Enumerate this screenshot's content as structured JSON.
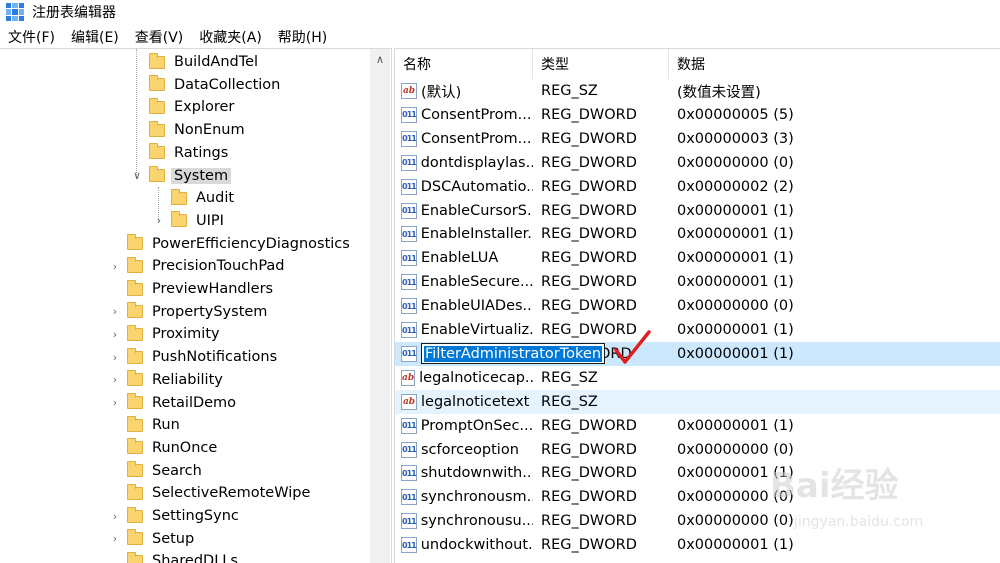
{
  "window": {
    "title": "注册表编辑器"
  },
  "menu": [
    "文件(F)",
    "编辑(E)",
    "查看(V)",
    "收藏夹(A)",
    "帮助(H)"
  ],
  "tree": {
    "nodes": [
      {
        "label": "BuildAndTel",
        "level": 2,
        "chevron": ""
      },
      {
        "label": "DataCollection",
        "level": 2,
        "chevron": ""
      },
      {
        "label": "Explorer",
        "level": 2,
        "chevron": ""
      },
      {
        "label": "NonEnum",
        "level": 2,
        "chevron": ""
      },
      {
        "label": "Ratings",
        "level": 2,
        "chevron": ""
      },
      {
        "label": "System",
        "level": 2,
        "chevron": "∨",
        "selected": true
      },
      {
        "label": "Audit",
        "level": 3,
        "chevron": ""
      },
      {
        "label": "UIPI",
        "level": 3,
        "chevron": "›"
      },
      {
        "label": "PowerEfficiencyDiagnostics",
        "level": 1,
        "chevron": ""
      },
      {
        "label": "PrecisionTouchPad",
        "level": 1,
        "chevron": "›"
      },
      {
        "label": "PreviewHandlers",
        "level": 1,
        "chevron": ""
      },
      {
        "label": "PropertySystem",
        "level": 1,
        "chevron": "›"
      },
      {
        "label": "Proximity",
        "level": 1,
        "chevron": "›"
      },
      {
        "label": "PushNotifications",
        "level": 1,
        "chevron": "›"
      },
      {
        "label": "Reliability",
        "level": 1,
        "chevron": "›"
      },
      {
        "label": "RetailDemo",
        "level": 1,
        "chevron": "›"
      },
      {
        "label": "Run",
        "level": 1,
        "chevron": ""
      },
      {
        "label": "RunOnce",
        "level": 1,
        "chevron": ""
      },
      {
        "label": "Search",
        "level": 1,
        "chevron": ""
      },
      {
        "label": "SelectiveRemoteWipe",
        "level": 1,
        "chevron": ""
      },
      {
        "label": "SettingSync",
        "level": 1,
        "chevron": "›"
      },
      {
        "label": "Setup",
        "level": 1,
        "chevron": "›"
      },
      {
        "label": "SharedDLLs",
        "level": 1,
        "chevron": ""
      }
    ]
  },
  "list": {
    "columns": [
      "名称",
      "类型",
      "数据"
    ],
    "rows": [
      {
        "name": "(默认)",
        "type": "REG_SZ",
        "data": "(数值未设置)",
        "icon": "ab"
      },
      {
        "name": "ConsentProm...",
        "type": "REG_DWORD",
        "data": "0x00000005 (5)",
        "icon": "bin"
      },
      {
        "name": "ConsentProm...",
        "type": "REG_DWORD",
        "data": "0x00000003 (3)",
        "icon": "bin"
      },
      {
        "name": "dontdisplaylas...",
        "type": "REG_DWORD",
        "data": "0x00000000 (0)",
        "icon": "bin"
      },
      {
        "name": "DSCAutomatio...",
        "type": "REG_DWORD",
        "data": "0x00000002 (2)",
        "icon": "bin"
      },
      {
        "name": "EnableCursorS...",
        "type": "REG_DWORD",
        "data": "0x00000001 (1)",
        "icon": "bin"
      },
      {
        "name": "EnableInstaller...",
        "type": "REG_DWORD",
        "data": "0x00000001 (1)",
        "icon": "bin"
      },
      {
        "name": "EnableLUA",
        "type": "REG_DWORD",
        "data": "0x00000001 (1)",
        "icon": "bin"
      },
      {
        "name": "EnableSecure...",
        "type": "REG_DWORD",
        "data": "0x00000001 (1)",
        "icon": "bin"
      },
      {
        "name": "EnableUIADes...",
        "type": "REG_DWORD",
        "data": "0x00000000 (0)",
        "icon": "bin"
      },
      {
        "name": "EnableVirtualiz...",
        "type": "REG_DWORD",
        "data": "0x00000001 (1)",
        "icon": "bin"
      },
      {
        "name": "FilterAdministratorToken",
        "type": "ORD",
        "data": "0x00000001 (1)",
        "icon": "bin",
        "editing": true
      },
      {
        "name": "legalnoticecap...",
        "type": "REG_SZ",
        "data": "",
        "icon": "ab"
      },
      {
        "name": "legalnoticetext",
        "type": "REG_SZ",
        "data": "",
        "icon": "ab",
        "hover": true
      },
      {
        "name": "PromptOnSec...",
        "type": "REG_DWORD",
        "data": "0x00000001 (1)",
        "icon": "bin"
      },
      {
        "name": "scforceoption",
        "type": "REG_DWORD",
        "data": "0x00000000 (0)",
        "icon": "bin"
      },
      {
        "name": "shutdownwith...",
        "type": "REG_DWORD",
        "data": "0x00000001 (1)",
        "icon": "bin"
      },
      {
        "name": "synchronousm...",
        "type": "REG_DWORD",
        "data": "0x00000000 (0)",
        "icon": "bin"
      },
      {
        "name": "synchronousu...",
        "type": "REG_DWORD",
        "data": "0x00000000 (0)",
        "icon": "bin"
      },
      {
        "name": "undockwithout...",
        "type": "REG_DWORD",
        "data": "0x00000001 (1)",
        "icon": "bin"
      }
    ]
  },
  "icons": {
    "up_arrow": "∧",
    "ab": "ab",
    "bin": "011"
  },
  "watermark": {
    "brand": "Bai经验",
    "url": "jingyan.baidu.com"
  },
  "colors": {
    "selection": "#cce8ff",
    "checkmark": "#e02020",
    "rename_highlight": "#0078d7"
  }
}
